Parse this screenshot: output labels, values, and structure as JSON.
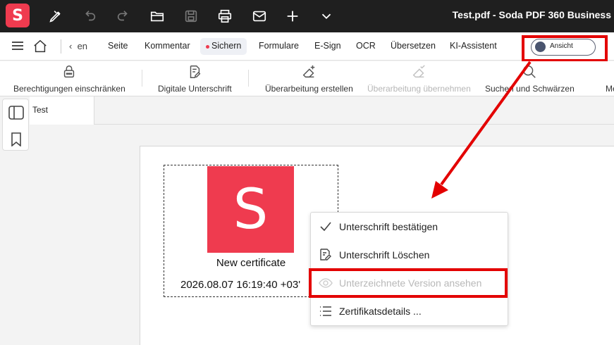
{
  "titlebar": {
    "logo_letter": "S",
    "title": "Test.pdf   -   Soda PDF 360 Business"
  },
  "menubar": {
    "back_label": "en",
    "items": [
      "Seite",
      "Kommentar",
      "Sichern",
      "Formulare",
      "E-Sign",
      "OCR",
      "Übersetzen",
      "KI-Assistent"
    ],
    "active": "Sichern",
    "view_toggle_label": "Ansicht"
  },
  "ribbon": {
    "tools": [
      {
        "label": "Berechtigungen einschränken",
        "icon": "lock-icon",
        "enabled": true
      },
      {
        "label": "Digitale Unterschrift",
        "icon": "signature-doc-icon",
        "enabled": true
      },
      {
        "label": "Überarbeitung erstellen",
        "icon": "eraser-plus-icon",
        "enabled": true
      },
      {
        "label": "Überarbeitung übernehmen",
        "icon": "eraser-check-icon",
        "enabled": false
      },
      {
        "label": "Suchen und Schwärzen",
        "icon": "search-icon",
        "enabled": true
      },
      {
        "label": "Me",
        "icon": "",
        "enabled": true
      }
    ]
  },
  "document": {
    "tab_label": "Test",
    "signature": {
      "logo_letter": "S",
      "name": "New certificate",
      "date": "2026.08.07 16:19:40 +03'"
    }
  },
  "context_menu": {
    "items": [
      {
        "label": "Unterschrift bestätigen",
        "icon": "checkmark-icon",
        "enabled": true
      },
      {
        "label": "Unterschrift Löschen",
        "icon": "signature-delete-icon",
        "enabled": true
      },
      {
        "label": "Unterzeichnete Version ansehen",
        "icon": "eye-icon",
        "enabled": false
      },
      {
        "label": "Zertifikatsdetails ...",
        "icon": "list-icon",
        "enabled": true
      }
    ]
  },
  "colors": {
    "brand": "#ef3b4f",
    "titlebar_bg": "#1f1f1f",
    "highlight": "#e30000"
  }
}
